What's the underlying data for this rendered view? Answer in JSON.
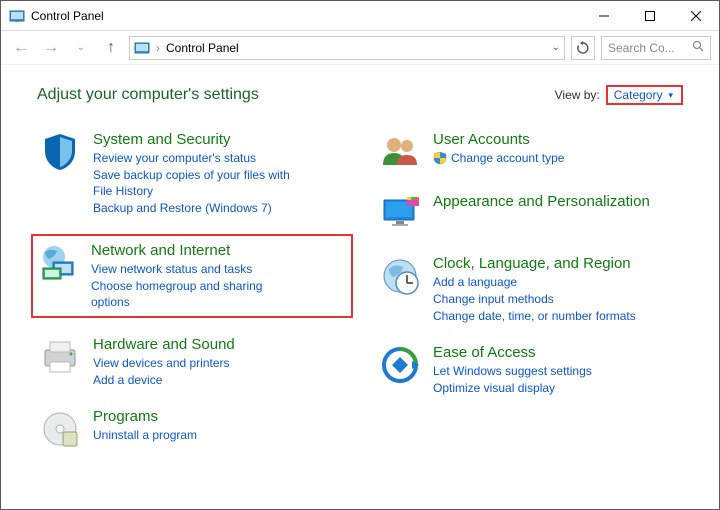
{
  "window": {
    "title": "Control Panel"
  },
  "breadcrumb": {
    "location": "Control Panel"
  },
  "search": {
    "placeholder": "Search Co..."
  },
  "header": {
    "title": "Adjust your computer's settings",
    "viewby_label": "View by:",
    "viewby_value": "Category"
  },
  "left": [
    {
      "title": "System and Security",
      "links": [
        "Review your computer's status",
        "Save backup copies of your files with File History",
        "Backup and Restore (Windows 7)"
      ]
    },
    {
      "title": "Network and Internet",
      "links": [
        "View network status and tasks",
        "Choose homegroup and sharing options"
      ]
    },
    {
      "title": "Hardware and Sound",
      "links": [
        "View devices and printers",
        "Add a device"
      ]
    },
    {
      "title": "Programs",
      "links": [
        "Uninstall a program"
      ]
    }
  ],
  "right": [
    {
      "title": "User Accounts",
      "links": [
        "Change account type"
      ],
      "uac": true
    },
    {
      "title": "Appearance and Personalization",
      "links": []
    },
    {
      "title": "Clock, Language, and Region",
      "links": [
        "Add a language",
        "Change input methods",
        "Change date, time, or number formats"
      ]
    },
    {
      "title": "Ease of Access",
      "links": [
        "Let Windows suggest settings",
        "Optimize visual display"
      ]
    }
  ]
}
